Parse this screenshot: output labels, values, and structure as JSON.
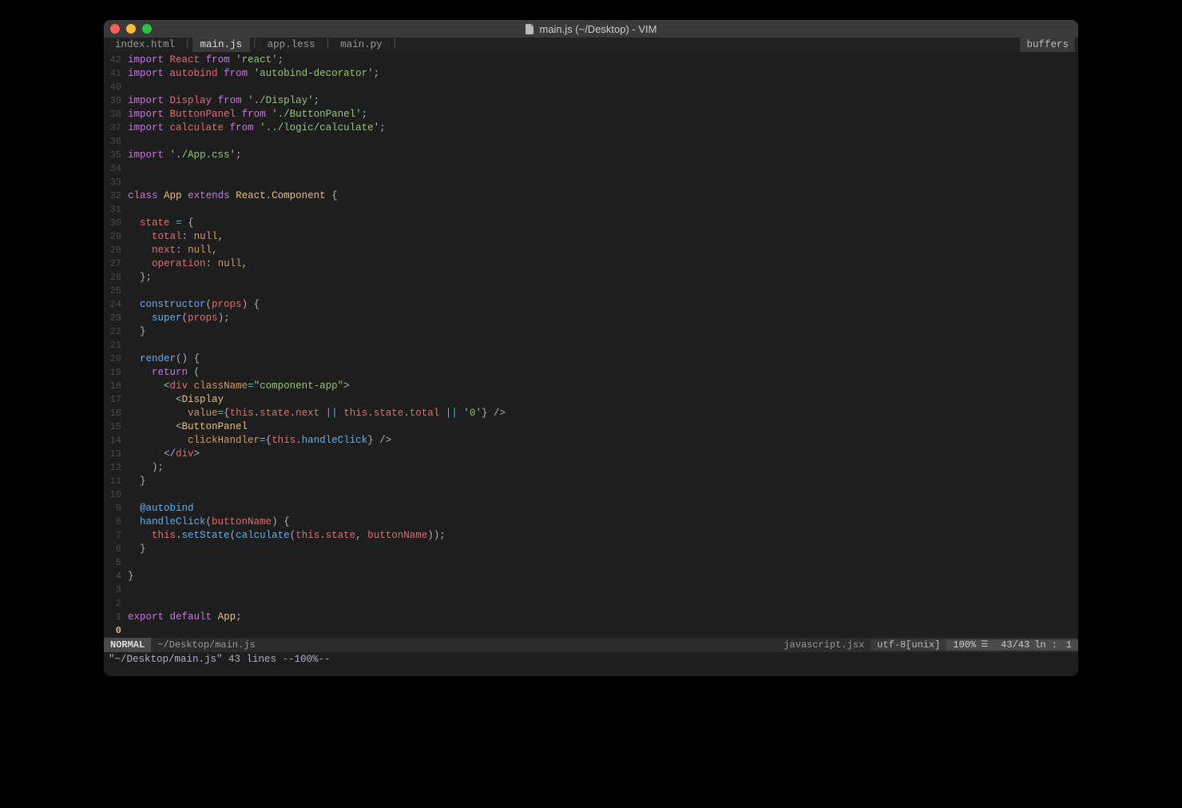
{
  "window": {
    "title": "main.js (~/Desktop) - VIM"
  },
  "tabs": {
    "items": [
      {
        "label": "index.html",
        "active": false
      },
      {
        "label": "main.js",
        "active": true
      },
      {
        "label": "app.less",
        "active": false
      },
      {
        "label": "main.py",
        "active": false
      }
    ],
    "buffers_label": "buffers"
  },
  "statusbar": {
    "mode": "NORMAL",
    "file": "~/Desktop/main.js",
    "filetype": "javascript.jsx",
    "encoding": "utf-8[unix]",
    "percent": "100%",
    "lines": "43/43",
    "col_label": "ln :",
    "col": "1"
  },
  "cmdline": "\"~/Desktop/main.js\" 43 lines --100%--",
  "cursor_line_display": "0",
  "lines": [
    {
      "n": 42,
      "tokens": [
        [
          "kw",
          "import"
        ],
        [
          "white",
          " "
        ],
        [
          "ident",
          "React"
        ],
        [
          "white",
          " "
        ],
        [
          "kw",
          "from"
        ],
        [
          "white",
          " "
        ],
        [
          "str",
          "'react'"
        ],
        [
          "punc",
          ";"
        ]
      ]
    },
    {
      "n": 41,
      "tokens": [
        [
          "kw",
          "import"
        ],
        [
          "white",
          " "
        ],
        [
          "ident",
          "autobind"
        ],
        [
          "white",
          " "
        ],
        [
          "kw",
          "from"
        ],
        [
          "white",
          " "
        ],
        [
          "str",
          "'autobind-decorator'"
        ],
        [
          "punc",
          ";"
        ]
      ]
    },
    {
      "n": 40,
      "tokens": []
    },
    {
      "n": 39,
      "tokens": [
        [
          "kw",
          "import"
        ],
        [
          "white",
          " "
        ],
        [
          "ident",
          "Display"
        ],
        [
          "white",
          " "
        ],
        [
          "kw",
          "from"
        ],
        [
          "white",
          " "
        ],
        [
          "str",
          "'./Display'"
        ],
        [
          "punc",
          ";"
        ]
      ]
    },
    {
      "n": 38,
      "tokens": [
        [
          "kw",
          "import"
        ],
        [
          "white",
          " "
        ],
        [
          "ident",
          "ButtonPanel"
        ],
        [
          "white",
          " "
        ],
        [
          "kw",
          "from"
        ],
        [
          "white",
          " "
        ],
        [
          "str",
          "'./ButtonPanel'"
        ],
        [
          "punc",
          ";"
        ]
      ]
    },
    {
      "n": 37,
      "tokens": [
        [
          "kw",
          "import"
        ],
        [
          "white",
          " "
        ],
        [
          "ident",
          "calculate"
        ],
        [
          "white",
          " "
        ],
        [
          "kw",
          "from"
        ],
        [
          "white",
          " "
        ],
        [
          "str",
          "'../logic/calculate'"
        ],
        [
          "punc",
          ";"
        ]
      ]
    },
    {
      "n": 36,
      "tokens": []
    },
    {
      "n": 35,
      "tokens": [
        [
          "kw",
          "import"
        ],
        [
          "white",
          " "
        ],
        [
          "str",
          "'./App.css'"
        ],
        [
          "punc",
          ";"
        ]
      ]
    },
    {
      "n": 34,
      "tokens": []
    },
    {
      "n": 33,
      "tokens": []
    },
    {
      "n": 32,
      "tokens": [
        [
          "kw",
          "class"
        ],
        [
          "white",
          " "
        ],
        [
          "type",
          "App"
        ],
        [
          "white",
          " "
        ],
        [
          "kw",
          "extends"
        ],
        [
          "white",
          " "
        ],
        [
          "type",
          "React"
        ],
        [
          "punc",
          "."
        ],
        [
          "type",
          "Component"
        ],
        [
          "white",
          " "
        ],
        [
          "punc",
          "{"
        ]
      ]
    },
    {
      "n": 31,
      "tokens": []
    },
    {
      "n": 30,
      "tokens": [
        [
          "white",
          "  "
        ],
        [
          "prop",
          "state"
        ],
        [
          "white",
          " "
        ],
        [
          "op",
          "="
        ],
        [
          "white",
          " "
        ],
        [
          "punc",
          "{"
        ]
      ]
    },
    {
      "n": 29,
      "tokens": [
        [
          "white",
          "    "
        ],
        [
          "prop",
          "total"
        ],
        [
          "punc",
          ":"
        ],
        [
          "white",
          " "
        ],
        [
          "null",
          "null"
        ],
        [
          "punc",
          ","
        ]
      ]
    },
    {
      "n": 28,
      "tokens": [
        [
          "white",
          "    "
        ],
        [
          "prop",
          "next"
        ],
        [
          "punc",
          ":"
        ],
        [
          "white",
          " "
        ],
        [
          "null",
          "null"
        ],
        [
          "punc",
          ","
        ]
      ]
    },
    {
      "n": 27,
      "tokens": [
        [
          "white",
          "    "
        ],
        [
          "prop",
          "operation"
        ],
        [
          "punc",
          ":"
        ],
        [
          "white",
          " "
        ],
        [
          "null",
          "null"
        ],
        [
          "punc",
          ","
        ]
      ]
    },
    {
      "n": 26,
      "tokens": [
        [
          "white",
          "  "
        ],
        [
          "punc",
          "};"
        ]
      ]
    },
    {
      "n": 25,
      "tokens": []
    },
    {
      "n": 24,
      "tokens": [
        [
          "white",
          "  "
        ],
        [
          "fn",
          "constructor"
        ],
        [
          "punc",
          "("
        ],
        [
          "param",
          "props"
        ],
        [
          "punc",
          ")"
        ],
        [
          "white",
          " "
        ],
        [
          "punc",
          "{"
        ]
      ]
    },
    {
      "n": 23,
      "tokens": [
        [
          "white",
          "    "
        ],
        [
          "fn",
          "super"
        ],
        [
          "punc",
          "("
        ],
        [
          "param",
          "props"
        ],
        [
          "punc",
          ")"
        ],
        [
          "punc",
          ";"
        ]
      ]
    },
    {
      "n": 22,
      "tokens": [
        [
          "white",
          "  "
        ],
        [
          "punc",
          "}"
        ]
      ]
    },
    {
      "n": 21,
      "tokens": []
    },
    {
      "n": 20,
      "tokens": [
        [
          "white",
          "  "
        ],
        [
          "fn",
          "render"
        ],
        [
          "punc",
          "()"
        ],
        [
          "white",
          " "
        ],
        [
          "punc",
          "{"
        ]
      ]
    },
    {
      "n": 19,
      "tokens": [
        [
          "white",
          "    "
        ],
        [
          "kw",
          "return"
        ],
        [
          "white",
          " "
        ],
        [
          "punc",
          "("
        ]
      ]
    },
    {
      "n": 18,
      "tokens": [
        [
          "white",
          "      "
        ],
        [
          "punc",
          "<"
        ],
        [
          "tag",
          "div"
        ],
        [
          "white",
          " "
        ],
        [
          "attr",
          "className"
        ],
        [
          "op",
          "="
        ],
        [
          "str",
          "\"component-app\""
        ],
        [
          "punc",
          ">"
        ]
      ]
    },
    {
      "n": 17,
      "tokens": [
        [
          "white",
          "        "
        ],
        [
          "punc",
          "<"
        ],
        [
          "type",
          "Display"
        ]
      ]
    },
    {
      "n": 16,
      "tokens": [
        [
          "white",
          "          "
        ],
        [
          "attr",
          "value"
        ],
        [
          "op",
          "="
        ],
        [
          "punc",
          "{"
        ],
        [
          "this",
          "this"
        ],
        [
          "punc",
          "."
        ],
        [
          "prop",
          "state"
        ],
        [
          "punc",
          "."
        ],
        [
          "prop",
          "next"
        ],
        [
          "white",
          " "
        ],
        [
          "op",
          "||"
        ],
        [
          "white",
          " "
        ],
        [
          "this",
          "this"
        ],
        [
          "punc",
          "."
        ],
        [
          "prop",
          "state"
        ],
        [
          "punc",
          "."
        ],
        [
          "prop",
          "total"
        ],
        [
          "white",
          " "
        ],
        [
          "op",
          "||"
        ],
        [
          "white",
          " "
        ],
        [
          "str",
          "'0'"
        ],
        [
          "punc",
          "}"
        ],
        [
          "white",
          " "
        ],
        [
          "punc",
          "/>"
        ]
      ]
    },
    {
      "n": 15,
      "tokens": [
        [
          "white",
          "        "
        ],
        [
          "punc",
          "<"
        ],
        [
          "type",
          "ButtonPanel"
        ]
      ]
    },
    {
      "n": 14,
      "tokens": [
        [
          "white",
          "          "
        ],
        [
          "attr",
          "clickHandler"
        ],
        [
          "op",
          "="
        ],
        [
          "punc",
          "{"
        ],
        [
          "this",
          "this"
        ],
        [
          "punc",
          "."
        ],
        [
          "fn",
          "handleClick"
        ],
        [
          "punc",
          "}"
        ],
        [
          "white",
          " "
        ],
        [
          "punc",
          "/>"
        ]
      ]
    },
    {
      "n": 13,
      "tokens": [
        [
          "white",
          "      "
        ],
        [
          "punc",
          "</"
        ],
        [
          "tag",
          "div"
        ],
        [
          "punc",
          ">"
        ]
      ]
    },
    {
      "n": 12,
      "tokens": [
        [
          "white",
          "    "
        ],
        [
          "punc",
          ");"
        ]
      ]
    },
    {
      "n": 11,
      "tokens": [
        [
          "white",
          "  "
        ],
        [
          "punc",
          "}"
        ]
      ]
    },
    {
      "n": 10,
      "tokens": []
    },
    {
      "n": 9,
      "tokens": [
        [
          "white",
          "  "
        ],
        [
          "deco",
          "@autobind"
        ]
      ]
    },
    {
      "n": 8,
      "tokens": [
        [
          "white",
          "  "
        ],
        [
          "fn",
          "handleClick"
        ],
        [
          "punc",
          "("
        ],
        [
          "param",
          "buttonName"
        ],
        [
          "punc",
          ")"
        ],
        [
          "white",
          " "
        ],
        [
          "punc",
          "{"
        ]
      ]
    },
    {
      "n": 7,
      "tokens": [
        [
          "white",
          "    "
        ],
        [
          "this",
          "this"
        ],
        [
          "punc",
          "."
        ],
        [
          "fn",
          "setState"
        ],
        [
          "punc",
          "("
        ],
        [
          "fn",
          "calculate"
        ],
        [
          "punc",
          "("
        ],
        [
          "this",
          "this"
        ],
        [
          "punc",
          "."
        ],
        [
          "prop",
          "state"
        ],
        [
          "punc",
          ","
        ],
        [
          "white",
          " "
        ],
        [
          "param",
          "buttonName"
        ],
        [
          "punc",
          "))"
        ],
        [
          "punc",
          ";"
        ]
      ]
    },
    {
      "n": 6,
      "tokens": [
        [
          "white",
          "  "
        ],
        [
          "punc",
          "}"
        ]
      ]
    },
    {
      "n": 5,
      "tokens": []
    },
    {
      "n": 4,
      "tokens": [
        [
          "punc",
          "}"
        ]
      ]
    },
    {
      "n": 3,
      "tokens": []
    },
    {
      "n": 2,
      "tokens": []
    },
    {
      "n": 1,
      "tokens": [
        [
          "kw",
          "export"
        ],
        [
          "white",
          " "
        ],
        [
          "kw",
          "default"
        ],
        [
          "white",
          " "
        ],
        [
          "type",
          "App"
        ],
        [
          "punc",
          ";"
        ]
      ]
    }
  ]
}
